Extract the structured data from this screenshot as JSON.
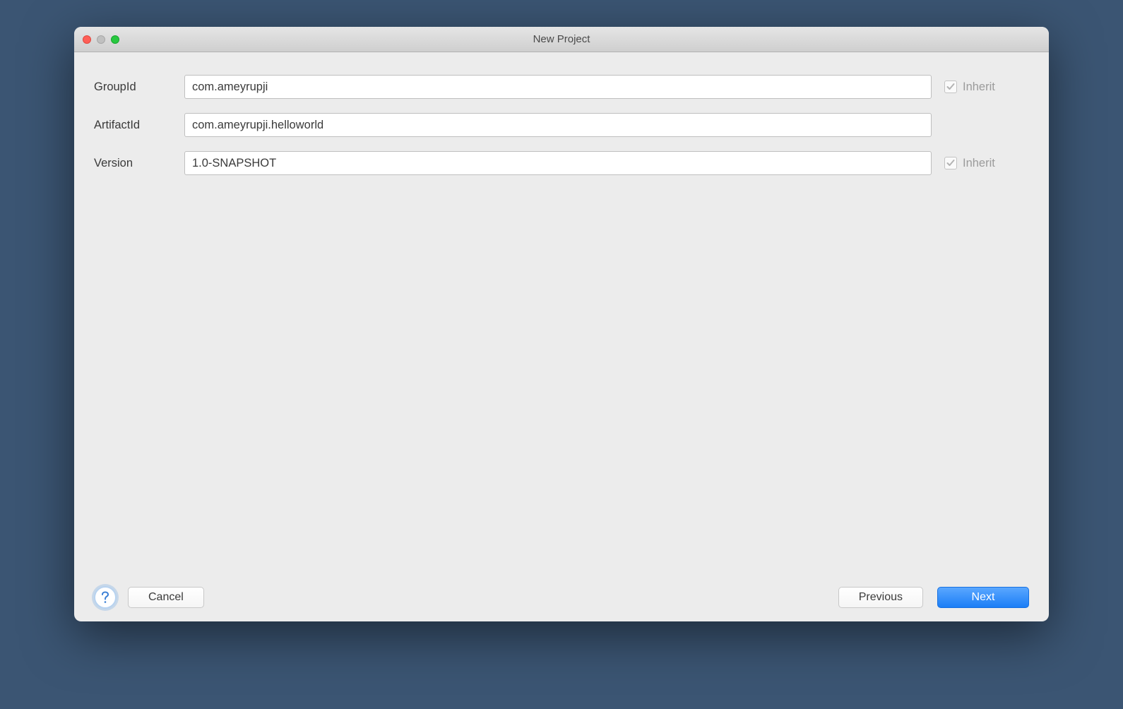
{
  "window": {
    "title": "New Project"
  },
  "form": {
    "groupId": {
      "label": "GroupId",
      "value": "com.ameyrupji",
      "inheritLabel": "Inherit",
      "inheritChecked": true
    },
    "artifactId": {
      "label": "ArtifactId",
      "value": "com.ameyrupji.helloworld"
    },
    "version": {
      "label": "Version",
      "value": "1.0-SNAPSHOT",
      "inheritLabel": "Inherit",
      "inheritChecked": true
    }
  },
  "buttons": {
    "cancel": "Cancel",
    "previous": "Previous",
    "next": "Next"
  }
}
